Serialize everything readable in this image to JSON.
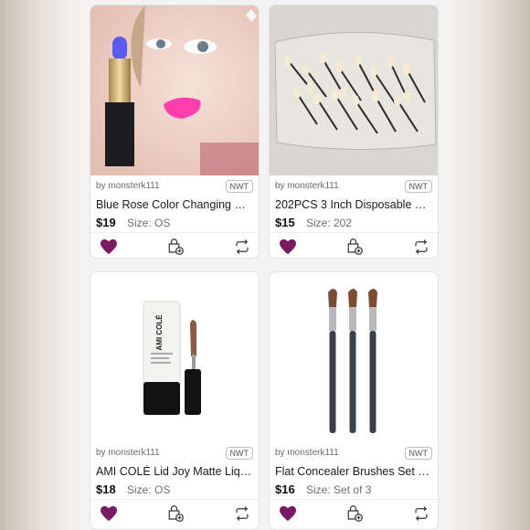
{
  "colors": {
    "heart": "#7a1a63",
    "accent": "#7a1a63"
  },
  "products": [
    {
      "image": "blue-lipstick-model-photo",
      "seller": "by monsterk111",
      "condition": "NWT",
      "title": "Blue Rose Color Changing Ma...",
      "price": "$19",
      "size": "Size: OS",
      "icons": {
        "like": "heart-icon",
        "bundle": "bag-plus-icon",
        "share": "share-icon"
      }
    },
    {
      "image": "applicators-in-bag-photo",
      "seller": "by monsterk111",
      "condition": "NWT",
      "title": "202PCS 3 Inch Disposable Eye...",
      "price": "$15",
      "size": "Size: 202",
      "icons": {
        "like": "heart-icon",
        "bundle": "bag-plus-icon",
        "share": "share-icon"
      }
    },
    {
      "image": "ami-cole-tube-photo",
      "seller": "by monsterk111",
      "condition": "NWT",
      "title": "AMI COLÉ Lid Joy Matte Liqui...",
      "price": "$18",
      "size": "Size: OS",
      "brand_text": "AMI COLÉ",
      "icons": {
        "like": "heart-icon",
        "bundle": "bag-plus-icon",
        "share": "share-icon"
      }
    },
    {
      "image": "concealer-brushes-photo",
      "seller": "by monsterk111",
      "condition": "NWT",
      "title": "Flat Concealer Brushes Set Pr...",
      "price": "$16",
      "size": "Size: Set of 3",
      "icons": {
        "like": "heart-icon",
        "bundle": "bag-plus-icon",
        "share": "share-icon"
      }
    }
  ]
}
